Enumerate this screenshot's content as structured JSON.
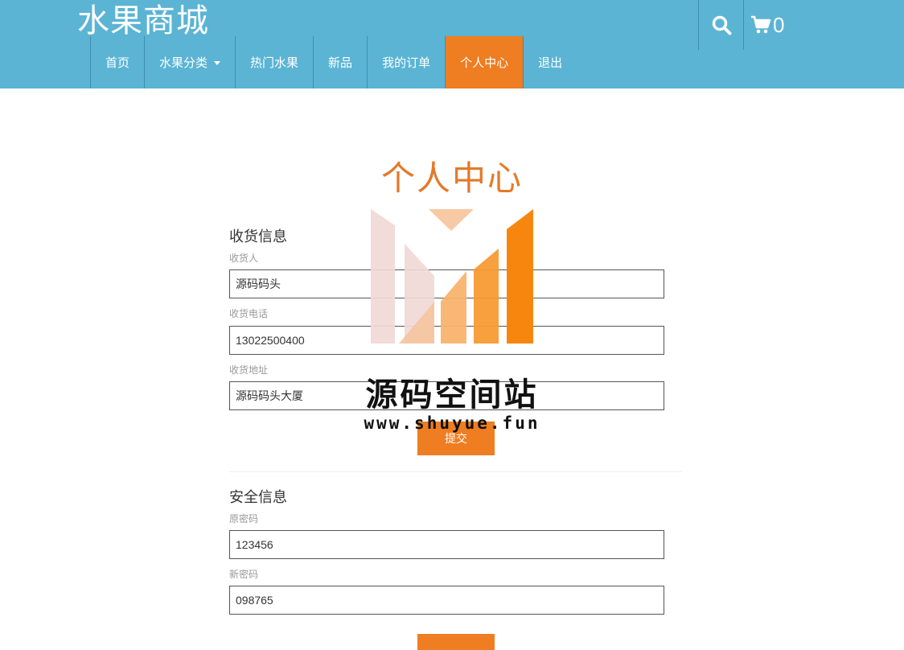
{
  "header": {
    "brand": "水果商城",
    "cart_count": "0",
    "nav": [
      {
        "label": "首页"
      },
      {
        "label": "水果分类"
      },
      {
        "label": "热门水果"
      },
      {
        "label": "新品"
      },
      {
        "label": "我的订单"
      },
      {
        "label": "个人中心"
      },
      {
        "label": "退出"
      }
    ],
    "active_nav": "个人中心"
  },
  "page": {
    "title": "个人中心"
  },
  "shipping": {
    "title": "收货信息",
    "receiver_label": "收货人",
    "receiver_value": "源码码头",
    "phone_label": "收货电话",
    "phone_value": "13022500400",
    "address_label": "收货地址",
    "address_value": "源码码头大厦",
    "submit_label": "提交"
  },
  "security": {
    "title": "安全信息",
    "old_password_label": "原密码",
    "old_password_value": "123456",
    "new_password_label": "新密码",
    "new_password_value": "098765"
  },
  "watermark": {
    "text": "源码空间站",
    "url": "www.shuyue.fun"
  },
  "colors": {
    "header_bg": "#5bb4d4",
    "accent": "#ef7d21",
    "title": "#e37a2a"
  },
  "icons": {
    "search": "search-icon",
    "cart": "cart-icon"
  }
}
